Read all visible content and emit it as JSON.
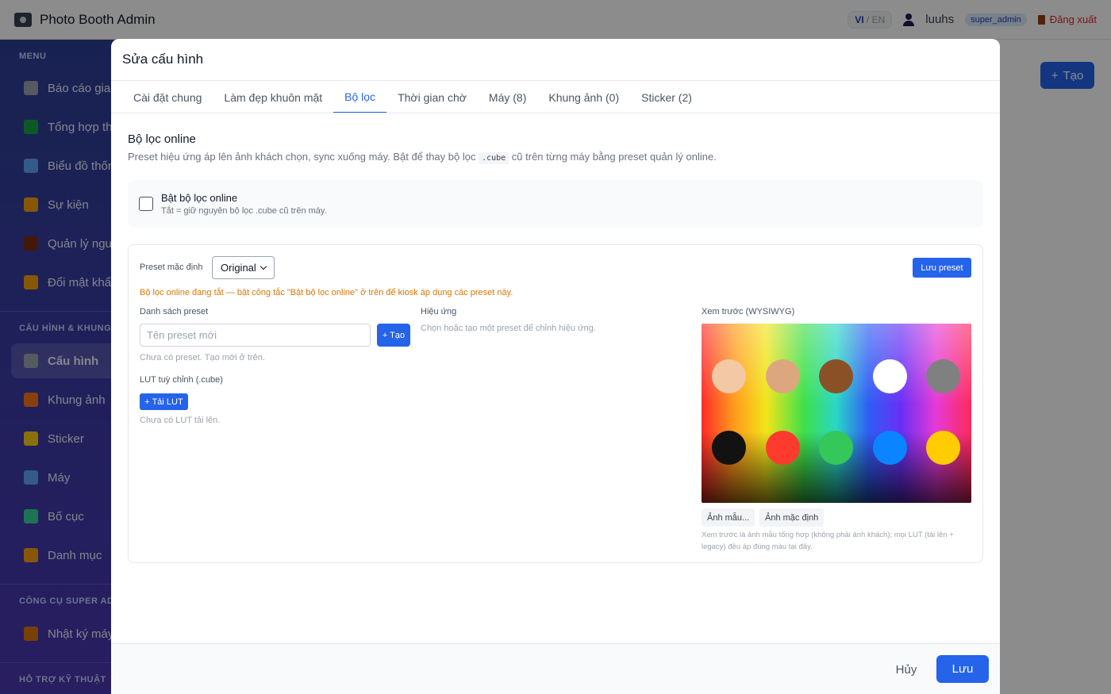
{
  "header": {
    "title": "Photo Booth Admin",
    "lang_vi": "VI",
    "lang_sep": "/",
    "lang_en": "EN",
    "username": "luuhs",
    "role": "super_admin",
    "logout": "Đăng xuất"
  },
  "sidebar": {
    "sections": [
      "MENU",
      "CẤU HÌNH & KHUNG",
      "CÔNG CỤ SUPER ADMIN",
      "HỖ TRỢ KỸ THUẬT"
    ],
    "items": [
      {
        "label": "Báo cáo giao dịch",
        "icon": "clipboard-icon",
        "color": "#9ca3af"
      },
      {
        "label": "Tổng hợp theo máy",
        "icon": "bar-chart-icon",
        "color": "#16a34a"
      },
      {
        "label": "Biểu đồ thống kê",
        "icon": "line-chart-icon",
        "color": "#60a5fa"
      },
      {
        "label": "Sự kiện",
        "icon": "party-icon",
        "color": "#f59e0b"
      },
      {
        "label": "Quản lý người dùng",
        "icon": "users-icon",
        "color": "#7c2d12"
      },
      {
        "label": "Đổi mật khẩu",
        "icon": "lock-icon",
        "color": "#f59e0b"
      },
      {
        "label": "Cấu hình",
        "icon": "gear-icon",
        "color": "#9ca3af",
        "active": true
      },
      {
        "label": "Khung ảnh",
        "icon": "palette-icon",
        "color": "#f97316"
      },
      {
        "label": "Sticker",
        "icon": "sparkle-icon",
        "color": "#facc15"
      },
      {
        "label": "Máy",
        "icon": "monitor-icon",
        "color": "#60a5fa"
      },
      {
        "label": "Bố cục",
        "icon": "picture-icon",
        "color": "#34d399"
      },
      {
        "label": "Danh mục",
        "icon": "tag-icon",
        "color": "#f59e0b"
      },
      {
        "label": "Nhật ký máy",
        "icon": "scroll-icon",
        "color": "#d97706"
      }
    ]
  },
  "main": {
    "create_label": "Tạo"
  },
  "modal": {
    "title": "Sửa cấu hình",
    "tabs": [
      {
        "label": "Cài đặt chung"
      },
      {
        "label": "Làm đẹp khuôn mặt"
      },
      {
        "label": "Bộ lọc",
        "active": true
      },
      {
        "label": "Thời gian chờ"
      },
      {
        "label": "Máy (8)"
      },
      {
        "label": "Khung ảnh (0)"
      },
      {
        "label": "Sticker (2)"
      }
    ],
    "section_title": "Bộ lọc online",
    "section_desc_before": "Preset hiệu ứng áp lên ảnh khách chọn, sync xuống máy. Bật để thay bộ lọc ",
    "section_desc_code": ".cube",
    "section_desc_after": " cũ trên từng máy bằng preset quản lý online.",
    "toggle_label": "Bật bộ lọc online",
    "toggle_sub": "Tắt = giữ nguyên bộ lọc .cube cũ trên máy.",
    "toggle_checked": false,
    "preset_default_label": "Preset mặc định",
    "preset_default_value": "Original",
    "save_preset": "Lưu preset",
    "warning": "Bộ lọc online đang tắt — bật công tắc \"Bật bộ lọc online\" ở trên để kiosk áp dụng các preset này.",
    "preset_list_label": "Danh sách preset",
    "preset_input_placeholder": "Tên preset mới",
    "preset_create": "+ Tạo",
    "preset_empty": "Chưa có preset. Tạo mới ở trên.",
    "lut_label": "LUT tuỳ chỉnh (.cube)",
    "lut_upload": "+ Tải LUT",
    "lut_empty": "Chưa có LUT tải lên.",
    "effects_label": "Hiệu ứng",
    "effects_hint": "Chọn hoặc tạo một preset để chỉnh hiệu ứng.",
    "preview_label": "Xem trước (WYSIWYG)",
    "preview_swatches": [
      "#f2c9a4",
      "#dca67e",
      "#8a5126",
      "#ffffff",
      "#808080",
      "#121212",
      "#ff3b30",
      "#34c759",
      "#0a84ff",
      "#ffcc00"
    ],
    "sample_image": "Ảnh mẫu...",
    "default_image": "Ảnh mặc định",
    "preview_note": "Xem trước là ảnh mẫu tổng hợp (không phải ảnh khách); mọi LUT (tải lên + legacy) đều áp đúng màu tại đây.",
    "cancel": "Hủy",
    "save": "Lưu"
  }
}
